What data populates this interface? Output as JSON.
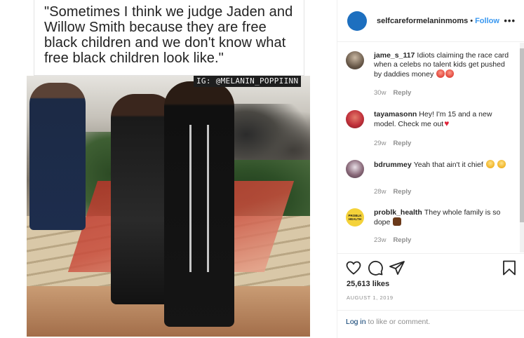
{
  "post": {
    "quote": "\"Sometimes I think we judge Jaden and Willow Smith because they are free black children and we don't know what free black children look like.\"",
    "watermark": "IG: @MELANIN_POPPIINN"
  },
  "header": {
    "username": "selfcareformelaninmoms",
    "separator": "•",
    "follow_label": "Follow",
    "more_icon": "more-icon",
    "avatar_color": "#1d6fbf"
  },
  "comments": [
    {
      "username": "jame_s_117",
      "text": "Idiots claiming the race card when a celebs no talent kids get pushed by daddies money",
      "emoji": [
        "angry-face-icon",
        "angry-face-icon"
      ],
      "time": "30w",
      "reply_label": "Reply",
      "avatar_color": "#6a5a4a"
    },
    {
      "username": "tayamasonn",
      "text": "Hey! I'm 15 and a new model. Check me out",
      "emoji": [
        "heart-icon"
      ],
      "time": "29w",
      "reply_label": "Reply",
      "avatar_color": "#c0303a"
    },
    {
      "username": "bdrummey",
      "text": "Yeah that ain't it chief",
      "emoji": [
        "laughing-face-icon",
        "laughing-face-icon"
      ],
      "time": "28w",
      "reply_label": "Reply",
      "avatar_color": "#6a4e5a"
    },
    {
      "username": "problk_health",
      "text": "They whole family is so dope",
      "emoji": [
        "raised-fist-icon"
      ],
      "time": "23w",
      "reply_label": "Reply",
      "avatar_color": "#f4d23a",
      "avatar_text": "PROBLK HEALTH"
    }
  ],
  "actions": {
    "like_icon": "heart-outline-icon",
    "comment_icon": "comment-icon",
    "share_icon": "share-icon",
    "save_icon": "bookmark-icon",
    "likes": "25,613 likes",
    "date": "AUGUST 1, 2019",
    "login_link": "Log in",
    "login_suffix": " to like or comment."
  },
  "colors": {
    "link_blue": "#3897f0",
    "muted_gray": "#8e8e8e",
    "dark_link": "#00376b"
  }
}
